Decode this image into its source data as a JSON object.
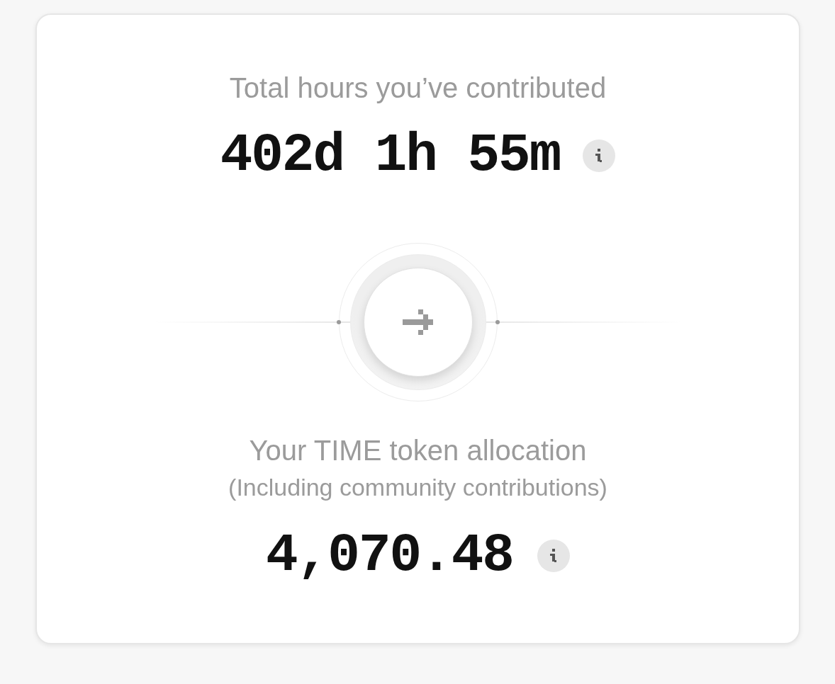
{
  "hours": {
    "label": "Total hours you’ve contributed",
    "value": "402d 1h 55m"
  },
  "allocation": {
    "label": "Your TIME token allocation",
    "note": "(Including community contributions)",
    "value": "4,070.48"
  }
}
